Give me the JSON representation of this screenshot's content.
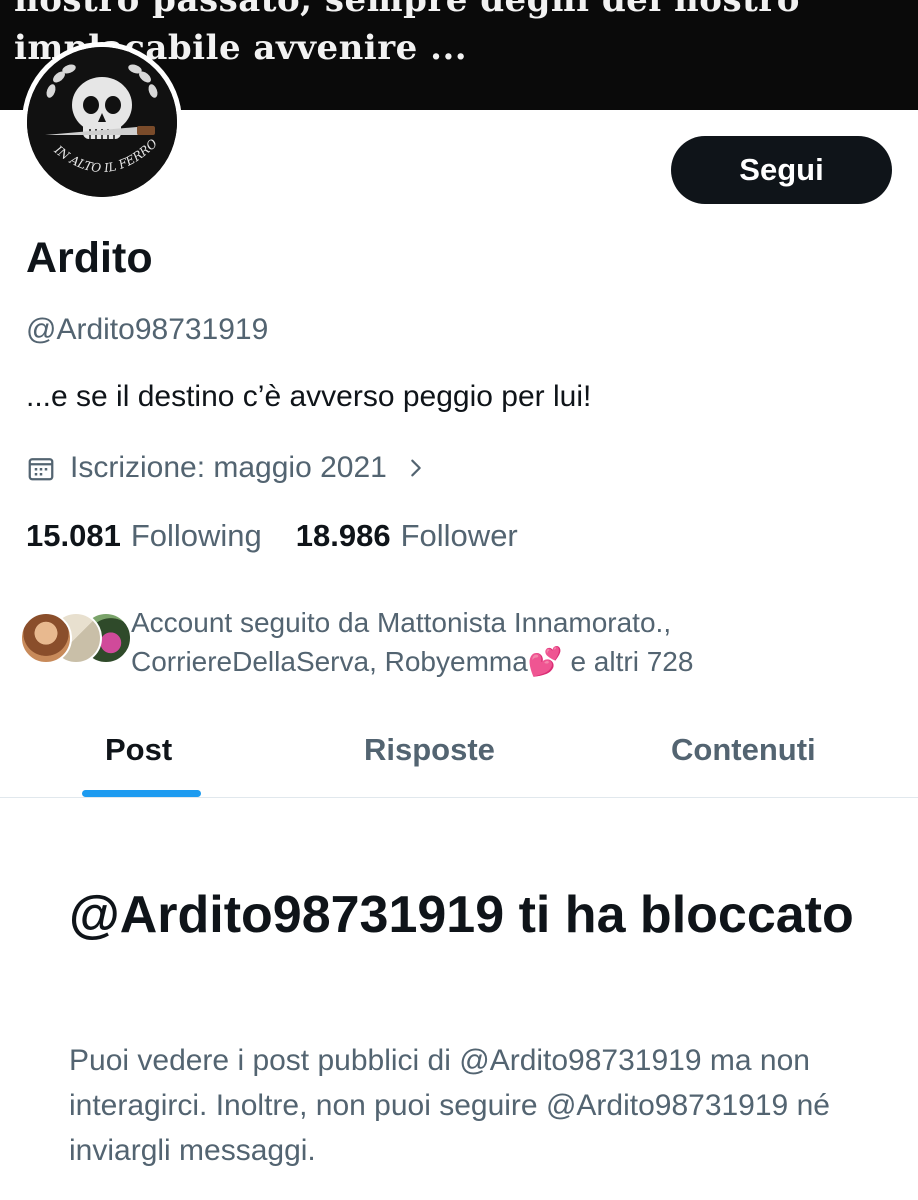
{
  "banner": {
    "line1": "nostro passato, sempre degni del nostro",
    "line2": "implacabile avvenire ..."
  },
  "avatar": {
    "text": "IN ALTO IL FERRO !"
  },
  "profile": {
    "follow_label": "Segui",
    "display_name": "Ardito",
    "handle": "@Ardito98731919",
    "bio": "...e se il destino c’è avverso peggio per lui!",
    "joined": "Iscrizione: maggio 2021"
  },
  "stats": {
    "following_count": "15.081",
    "following_label": "Following",
    "followers_count": "18.986",
    "followers_label": "Follower"
  },
  "followed_by": {
    "line1": "Account seguito da Mattonista Innamorato.,",
    "line2": "CorriereDellaServa, Robyemma💕 e altri 728"
  },
  "tabs": [
    {
      "label": "Post",
      "active": true
    },
    {
      "label": "Risposte",
      "active": false
    },
    {
      "label": "Contenuti",
      "active": false
    }
  ],
  "blocked": {
    "title": "@Ardito98731919 ti ha bloccato",
    "description": "Puoi vedere i post pubblici di @Ardito98731919 ma non interagirci. Inoltre, non puoi seguire @Ardito98731919 né inviargli messaggi."
  },
  "icons": {
    "calendar": "calendar-icon",
    "chevron": "chevron-right-icon"
  },
  "colors": {
    "accent": "#1d9bf0",
    "text_primary": "#0f1419",
    "text_secondary": "#536471",
    "button_bg": "#0f1419"
  }
}
